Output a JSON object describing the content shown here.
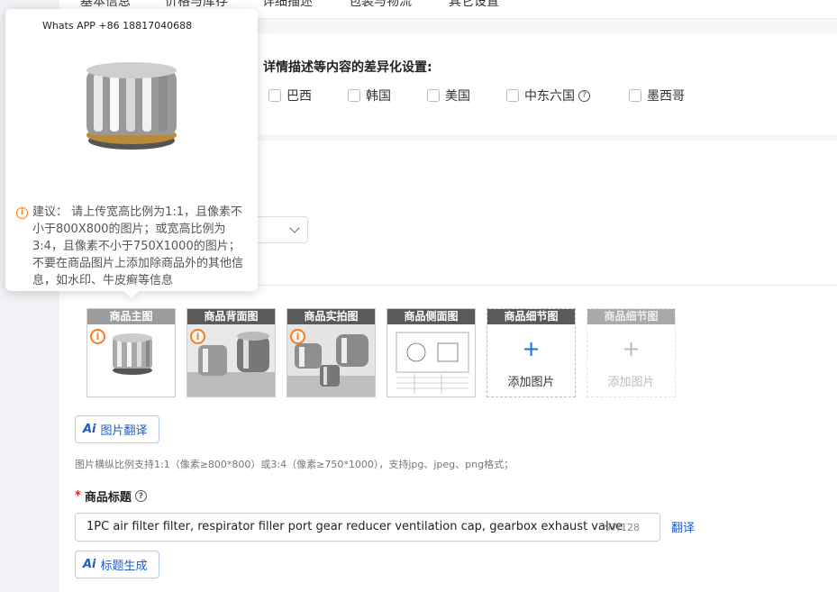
{
  "nav": {
    "tabs": [
      "基本信息",
      "价格与库存",
      "详细描述",
      "包装与物流",
      "其它设置"
    ]
  },
  "diff": {
    "title": "详情描述等内容的差异化设置:",
    "regions": [
      "巴西",
      "韩国",
      "美国",
      "中东六国",
      "墨西哥"
    ]
  },
  "images": {
    "slots": [
      {
        "label": "商品主图"
      },
      {
        "label": "商品背面图"
      },
      {
        "label": "商品实拍图"
      },
      {
        "label": "商品侧面图"
      },
      {
        "label": "商品细节图",
        "add_text": "添加图片"
      },
      {
        "label": "商品细节图",
        "add_text": "添加图片"
      }
    ],
    "translate_button": "图片翻译",
    "hint": "图片横纵比例支持1:1（像素≥800*800）或3:4（像素≥750*1000），支持jpg、jpeg、png格式；"
  },
  "product_title": {
    "label": "商品标题",
    "value": "1PC air filter filter, respirator filler port gear reducer ventilation cap, gearbox exhaust valve",
    "count": "97/128",
    "translate": "翻译",
    "generate_button": "标题生成"
  },
  "tooltip": {
    "watermark": "Whats APP +86 18817040688",
    "suggestion": "建议： 请上传宽高比例为1:1，且像素不小于800X800的图片；或宽高比例为3:4，且像素不小于750X1000的图片；不要在商品图片上添加除商品外的其他信息，如水印、牛皮癣等信息"
  },
  "icons": {
    "warn": "warning-circle-icon",
    "help": "question-circle-icon",
    "plus": "plus-icon",
    "ai": "ai-icon",
    "chevron": "chevron-down-icon"
  },
  "colors": {
    "accent": "#1e5bc6",
    "warn": "#ff7a1a",
    "required": "#e02020"
  }
}
